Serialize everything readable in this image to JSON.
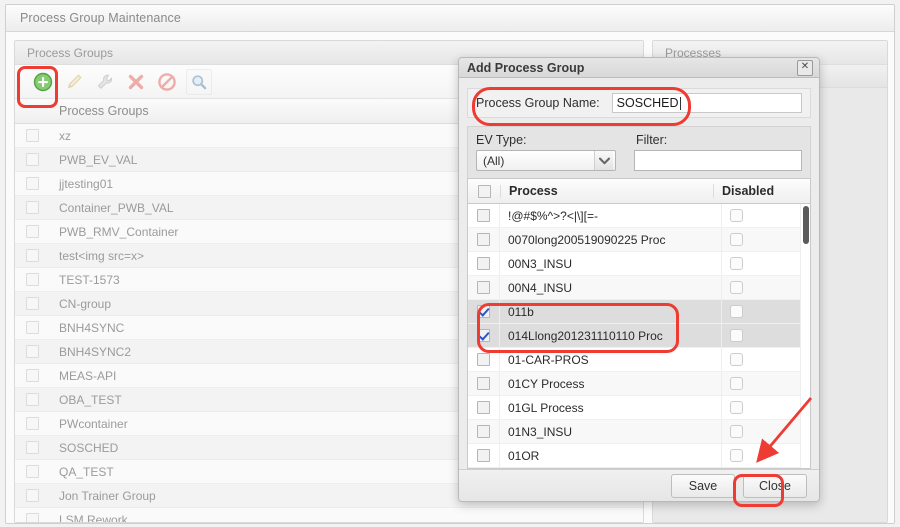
{
  "window": {
    "title": "Process Group Maintenance"
  },
  "panels": {
    "groups": {
      "header": "Process Groups",
      "column_header": "Process Groups",
      "toolbar": [
        {
          "name": "add-icon",
          "label": "Add",
          "enabled": true
        },
        {
          "name": "edit-pencil-icon",
          "label": "Edit",
          "enabled": false
        },
        {
          "name": "wrench-icon",
          "label": "Configure",
          "enabled": false
        },
        {
          "name": "delete-x-icon",
          "label": "Delete",
          "enabled": false
        },
        {
          "name": "disable-circle-icon",
          "label": "Disable",
          "enabled": false
        },
        {
          "name": "search-magnifier-icon",
          "label": "Search",
          "enabled": false
        }
      ],
      "rows": [
        "xz",
        "PWB_EV_VAL",
        "jjtesting01",
        "Container_PWB_VAL",
        "PWB_RMV_Container",
        "test<img src=x>",
        "TEST-1573",
        "CN-group",
        "BNH4SYNC",
        "BNH4SYNC2",
        "MEAS-API",
        "OBA_TEST",
        "PWcontainer",
        "SOSCHED",
        "QA_TEST",
        "Jon Trainer Group",
        "LSM Rework"
      ]
    },
    "processes": {
      "header": "Processes"
    }
  },
  "dialog": {
    "title": "Add Process Group",
    "close_label": "✕",
    "name_label": "Process Group Name:",
    "name_value": "SOSCHED",
    "name_placeholder": "",
    "ev_type_label": "EV Type:",
    "ev_type_value": "(All)",
    "ev_type_options": [
      "(All)"
    ],
    "filter_label": "Filter:",
    "filter_value": "",
    "filter_placeholder": "",
    "columns": {
      "process": "Process",
      "disabled": "Disabled"
    },
    "rows": [
      {
        "name": "!@#$%^>?<|\\][=-",
        "checked": false,
        "disabled": false
      },
      {
        "name": "0070long200519090225 Proc",
        "checked": false,
        "disabled": false
      },
      {
        "name": "00N3_INSU",
        "checked": false,
        "disabled": false
      },
      {
        "name": "00N4_INSU",
        "checked": false,
        "disabled": false
      },
      {
        "name": "011b",
        "checked": true,
        "disabled": false
      },
      {
        "name": "014Llong201231110110 Proc",
        "checked": true,
        "disabled": false
      },
      {
        "name": "01-CAR-PROS",
        "checked": false,
        "disabled": false
      },
      {
        "name": "01CY Process",
        "checked": false,
        "disabled": false
      },
      {
        "name": "01GL Process",
        "checked": false,
        "disabled": false
      },
      {
        "name": "01N3_INSU",
        "checked": false,
        "disabled": false
      },
      {
        "name": "01OR",
        "checked": false,
        "disabled": false
      }
    ],
    "buttons": {
      "save": "Save",
      "close": "Close"
    }
  },
  "annotations": {
    "highlight_color": "#ee3b33",
    "items": [
      {
        "name": "add-button-highlight"
      },
      {
        "name": "process-group-name-highlight"
      },
      {
        "name": "selected-rows-highlight"
      },
      {
        "name": "save-button-highlight"
      },
      {
        "name": "save-button-arrow"
      }
    ]
  }
}
